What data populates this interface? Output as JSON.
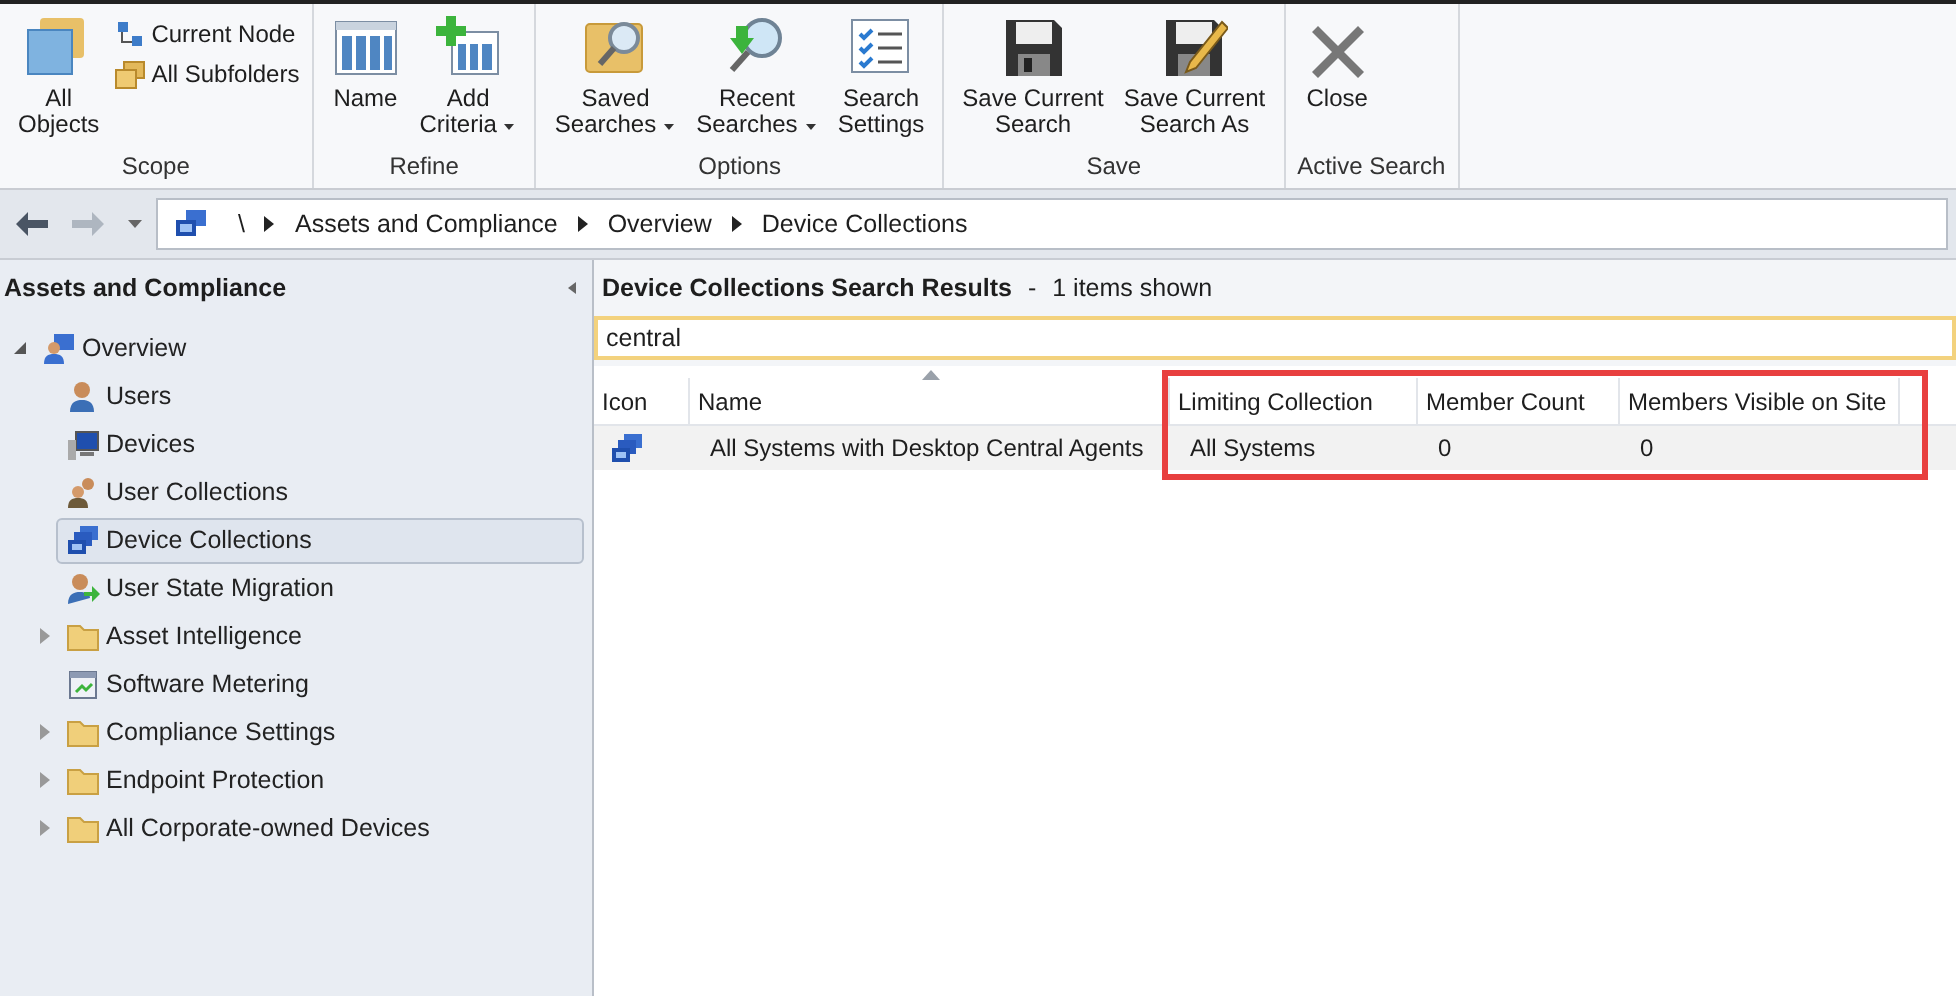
{
  "ribbon": {
    "groups": [
      {
        "label": "Scope",
        "buttons": [
          {
            "kind": "large",
            "label": "All\nObjects",
            "dropdown": false
          },
          {
            "kind": "small",
            "label": "Current Node",
            "dropdown": false
          },
          {
            "kind": "small",
            "label": "All Subfolders",
            "dropdown": false
          }
        ]
      },
      {
        "label": "Refine",
        "buttons": [
          {
            "kind": "large",
            "label": "Name",
            "dropdown": false
          },
          {
            "kind": "large",
            "label": "Add\nCriteria",
            "dropdown": true
          }
        ]
      },
      {
        "label": "Options",
        "buttons": [
          {
            "kind": "large",
            "label": "Saved\nSearches",
            "dropdown": true
          },
          {
            "kind": "large",
            "label": "Recent\nSearches",
            "dropdown": true
          },
          {
            "kind": "large",
            "label": "Search\nSettings",
            "dropdown": false
          }
        ]
      },
      {
        "label": "Save",
        "buttons": [
          {
            "kind": "large",
            "label": "Save Current\nSearch",
            "dropdown": false
          },
          {
            "kind": "large",
            "label": "Save Current\nSearch As",
            "dropdown": false
          }
        ]
      },
      {
        "label": "Active Search",
        "buttons": [
          {
            "kind": "large",
            "label": "Close",
            "dropdown": false
          }
        ]
      }
    ]
  },
  "nav": {
    "breadcrumb": [
      "\\",
      "Assets and Compliance",
      "Overview",
      "Device Collections"
    ]
  },
  "sidebar": {
    "title": "Assets and Compliance",
    "tree": [
      {
        "label": "Overview",
        "expanded": true,
        "selected": false,
        "children": [
          {
            "label": "Users",
            "expandable": false,
            "selected": false
          },
          {
            "label": "Devices",
            "expandable": false,
            "selected": false
          },
          {
            "label": "User Collections",
            "expandable": false,
            "selected": false
          },
          {
            "label": "Device Collections",
            "expandable": false,
            "selected": true
          },
          {
            "label": "User State Migration",
            "expandable": false,
            "selected": false
          },
          {
            "label": "Asset Intelligence",
            "expandable": true,
            "selected": false
          },
          {
            "label": "Software Metering",
            "expandable": false,
            "selected": false
          },
          {
            "label": "Compliance Settings",
            "expandable": true,
            "selected": false
          },
          {
            "label": "Endpoint Protection",
            "expandable": true,
            "selected": false
          },
          {
            "label": "All Corporate-owned Devices",
            "expandable": true,
            "selected": false
          }
        ]
      }
    ]
  },
  "results": {
    "title": "Device Collections Search Results",
    "separator": "-",
    "count": "1 items shown",
    "search": {
      "value": "central"
    },
    "table": {
      "columns": [
        {
          "label": "Icon",
          "sorted": false,
          "highlighted": false
        },
        {
          "label": "Name",
          "sorted": true,
          "highlighted": false
        },
        {
          "label": "Limiting Collection",
          "sorted": false,
          "highlighted": true
        },
        {
          "label": "Member Count",
          "sorted": false,
          "highlighted": true
        },
        {
          "label": "Members Visible on Site",
          "sorted": false,
          "highlighted": true
        }
      ],
      "rows": [
        {
          "cells": [
            "",
            "All Systems with Desktop Central Agents",
            "All Systems",
            "0",
            "0"
          ]
        }
      ]
    }
  }
}
